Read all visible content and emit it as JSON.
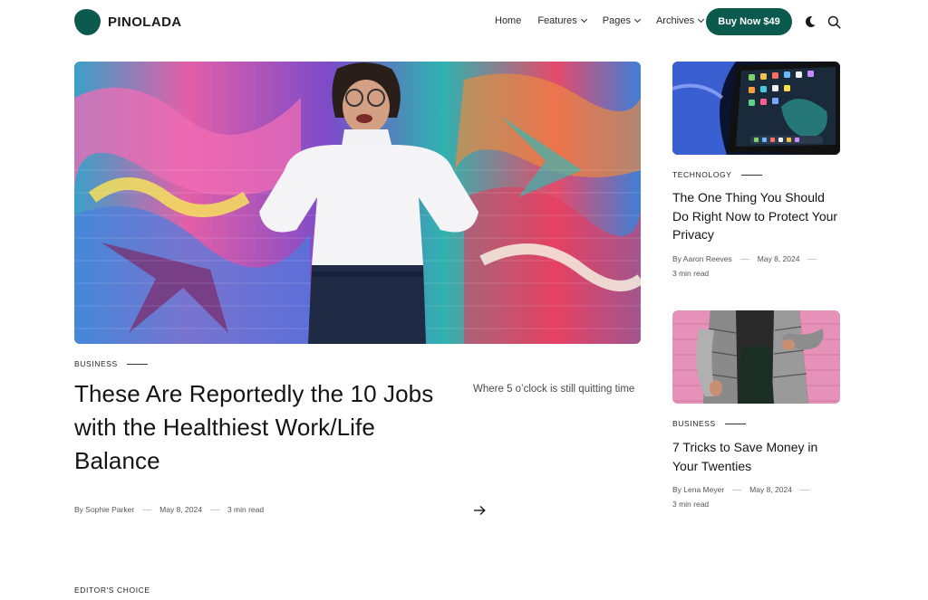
{
  "site": {
    "name": "PINOLADA",
    "brand_color": "#0c5a4e"
  },
  "nav": {
    "items": [
      {
        "label": "Home",
        "dropdown": false
      },
      {
        "label": "Features",
        "dropdown": true
      },
      {
        "label": "Pages",
        "dropdown": true
      },
      {
        "label": "Archives",
        "dropdown": true
      }
    ],
    "cta_label": "Buy Now $49",
    "icons": [
      "moon-icon",
      "search-icon"
    ]
  },
  "hero": {
    "category": "BUSINESS",
    "title": "These Are Reportedly the 10 Jobs with the Healthiest Work/Life Balance",
    "excerpt": "Where 5 o’clock is still quitting time",
    "author": "By Sophie Parker",
    "date": "May 8, 2024",
    "read_time": "3 min read"
  },
  "side_posts": [
    {
      "category": "TECHNOLOGY",
      "title": "The One Thing You Should Do Right Now to Protect Your Privacy",
      "author": "By Aaron Reeves",
      "date": "May 8, 2024",
      "read_time": "3 min read"
    },
    {
      "category": "BUSINESS",
      "title": "7 Tricks to Save Money in Your Twenties",
      "author": "By Lena Meyer",
      "date": "May 8, 2024",
      "read_time": "3 min read"
    }
  ],
  "section_label": "EDITOR'S CHOICE"
}
